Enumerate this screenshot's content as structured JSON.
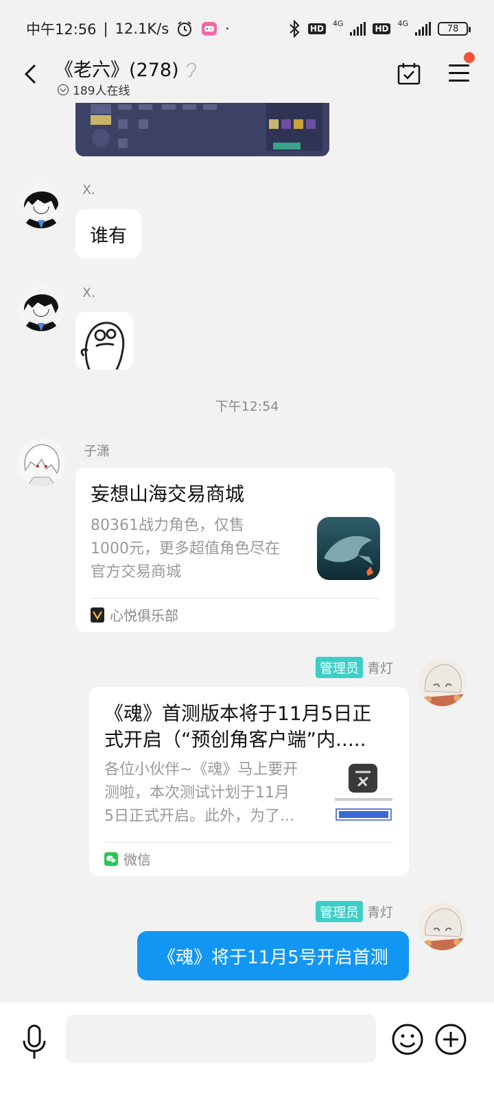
{
  "status_bar": {
    "time": "中午12:56",
    "speed": "12.1K/s",
    "battery": "78",
    "hd1": "HD",
    "hd2": "HD",
    "net1": "4G",
    "net2": "4G"
  },
  "header": {
    "title": "《老六》(278)",
    "online": "189人在线"
  },
  "messages": [
    {
      "sender": "X.",
      "text": "谁有"
    },
    {
      "sender": "X.",
      "sticker": "ghost-sticker"
    }
  ],
  "timestamp": "下午12:54",
  "card1": {
    "sender": "子潇",
    "title": "妄想山海交易商城",
    "desc_line1": "80361战力角色，仅售",
    "desc_line2": "1000元，更多超值角色尽在",
    "desc_line3": "官方交易商城",
    "source": "心悦俱乐部"
  },
  "card2": {
    "badge": "管理员",
    "sender": "青灯",
    "title_line1": "《魂》首测版本将于11月5日正",
    "title_line2": "式开启（“预创角客户端”内.....",
    "desc_line1": "各位小伙伴~《魂》马上要开",
    "desc_line2": "测啦，本次测试计划于11月",
    "desc_line3": "5日正式开启。此外，为了...",
    "source": "微信"
  },
  "message3": {
    "badge": "管理员",
    "sender": "青灯",
    "text": "《魂》将于11月5号开启首测"
  },
  "colors": {
    "accent": "#1296f4",
    "admin_badge": "#3ccfc7",
    "notification": "#f2533a",
    "wechat": "#2dc65a"
  }
}
